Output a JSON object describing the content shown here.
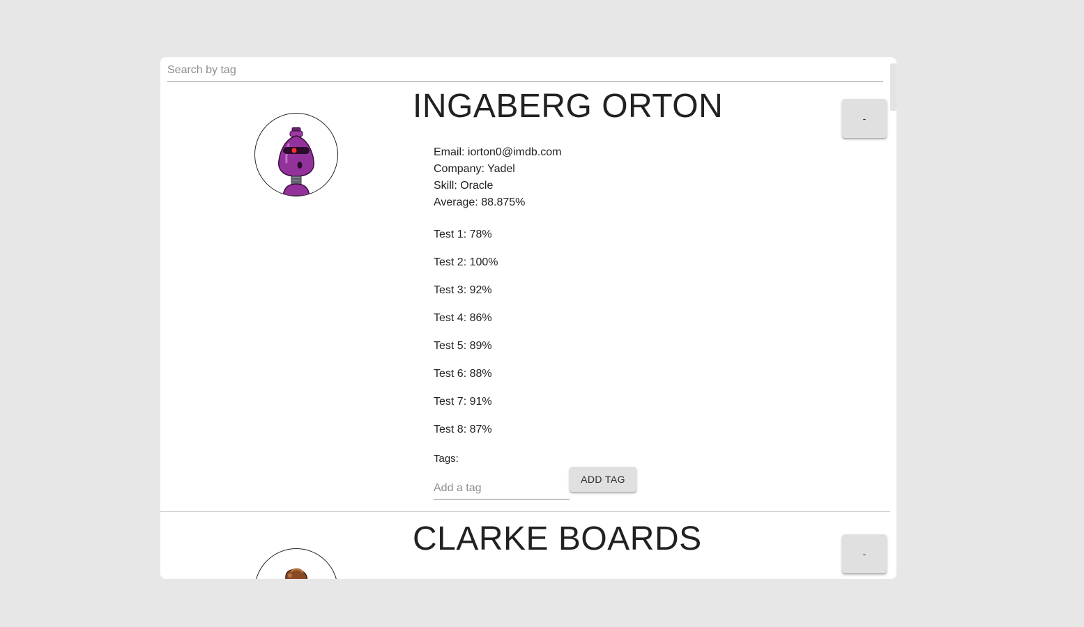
{
  "search": {
    "placeholder": "Search by tag",
    "value": ""
  },
  "students": [
    {
      "name": "INGABERG ORTON",
      "avatar_icon": "purple-robot-avatar",
      "toggle_label": "-",
      "email_label": "Email: iorton0@imdb.com",
      "company_label": "Company: Yadel",
      "skill_label": "Skill: Oracle",
      "average_label": "Average: 88.875%",
      "tests": [
        "Test 1: 78%",
        "Test 2: 100%",
        "Test 3: 92%",
        "Test 4: 86%",
        "Test 5: 89%",
        "Test 6: 88%",
        "Test 7: 91%",
        "Test 8: 87%"
      ],
      "tags_label": "Tags:",
      "tag_input_placeholder": "Add a tag",
      "add_tag_label": "ADD TAG"
    },
    {
      "name": "CLARKE BOARDS",
      "avatar_icon": "brown-robot-avatar",
      "toggle_label": "-"
    }
  ],
  "colors": {
    "page_background": "#e7e7e7",
    "card_background": "#ffffff",
    "button_background": "#e0e0e0",
    "avatar_1_primary": "#8e2a91",
    "avatar_2_primary": "#8a4a25"
  }
}
